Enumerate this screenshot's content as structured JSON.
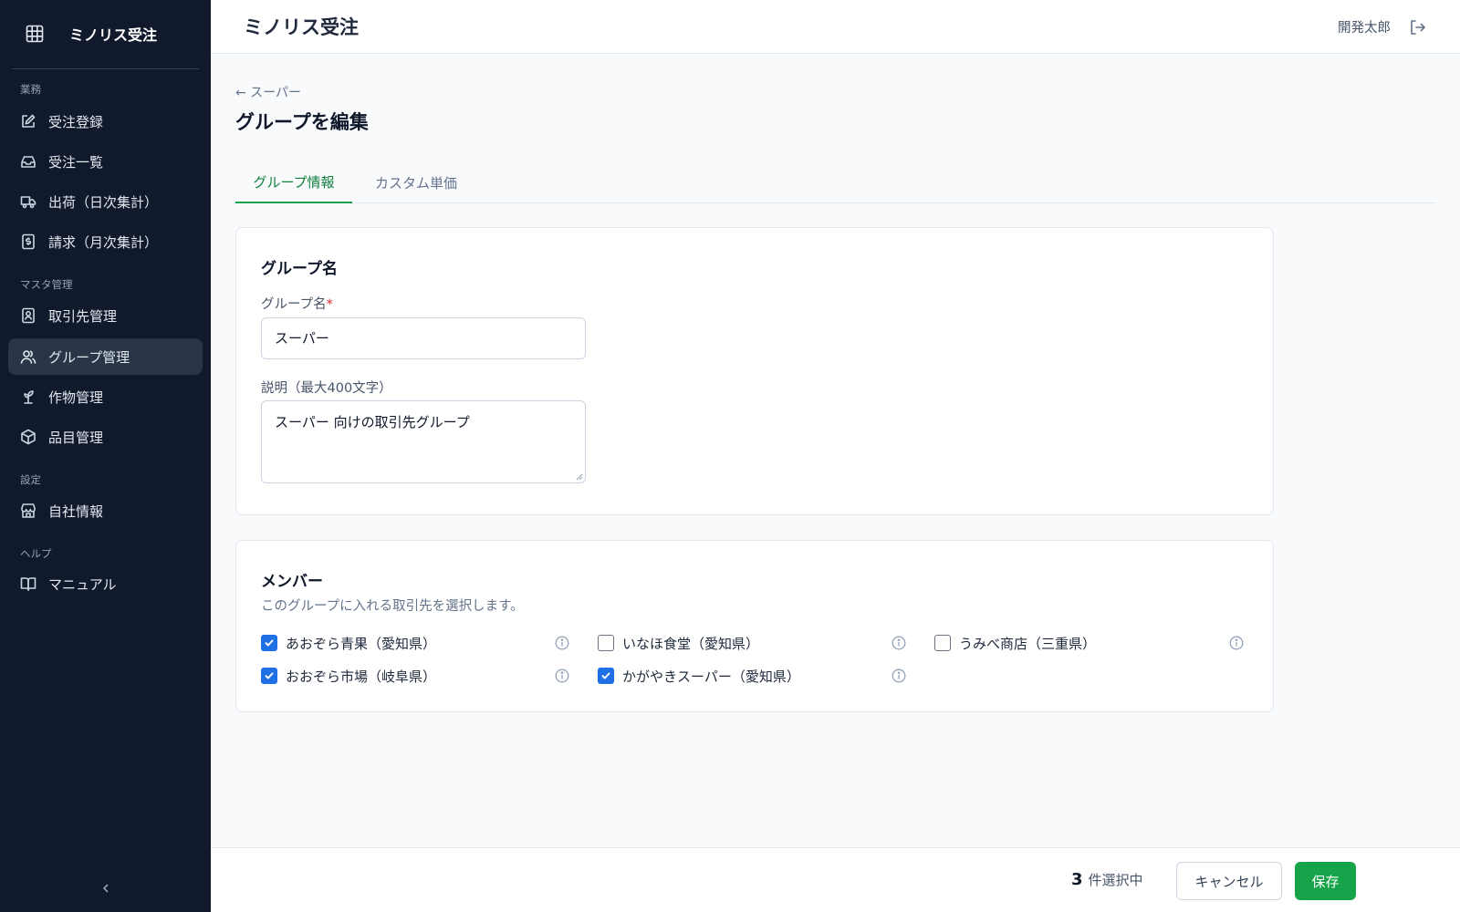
{
  "app": {
    "name": "ミノリス受注"
  },
  "header": {
    "title": "ミノリス受注",
    "user_name": "開発太郎"
  },
  "sidebar": {
    "sections": [
      {
        "label": "業務"
      },
      {
        "label": "マスタ管理"
      },
      {
        "label": "設定"
      },
      {
        "label": "ヘルプ"
      }
    ],
    "items": [
      {
        "label": "受注登録",
        "icon": "edit-icon"
      },
      {
        "label": "受注一覧",
        "icon": "inbox-icon"
      },
      {
        "label": "出荷（日次集計）",
        "icon": "truck-icon"
      },
      {
        "label": "請求（月次集計）",
        "icon": "invoice-icon"
      },
      {
        "label": "取引先管理",
        "icon": "contact-icon"
      },
      {
        "label": "グループ管理",
        "icon": "users-icon",
        "active": true
      },
      {
        "label": "作物管理",
        "icon": "sprout-icon"
      },
      {
        "label": "品目管理",
        "icon": "box-icon"
      },
      {
        "label": "自社情報",
        "icon": "store-icon"
      },
      {
        "label": "マニュアル",
        "icon": "book-icon"
      }
    ]
  },
  "page": {
    "back_label": "← スーパー",
    "title": "グループを編集"
  },
  "tabs": [
    {
      "label": "グループ情報",
      "active": true
    },
    {
      "label": "カスタム単価",
      "active": false
    }
  ],
  "group_card": {
    "title": "グループ名",
    "name_label": "グループ名",
    "required_mark": "*",
    "name_value": "スーパー",
    "desc_label": "説明（最大400文字）",
    "desc_value": "スーパー 向けの取引先グループ"
  },
  "members_card": {
    "title": "メンバー",
    "description": "このグループに入れる取引先を選択します。",
    "members": [
      {
        "label": "あおぞら青果（愛知県）",
        "checked": true
      },
      {
        "label": "いなほ食堂（愛知県）",
        "checked": false
      },
      {
        "label": "うみべ商店（三重県）",
        "checked": false
      },
      {
        "label": "おおぞら市場（岐阜県）",
        "checked": true
      },
      {
        "label": "かがやきスーパー（愛知県）",
        "checked": true
      }
    ]
  },
  "footer": {
    "selected_count": "3",
    "selected_suffix": "件選択中",
    "cancel_label": "キャンセル",
    "save_label": "保存"
  },
  "colors": {
    "sidebar_bg": "#111a2c",
    "accent_green": "#16a34a",
    "checkbox_blue": "#1f6fe5",
    "required_red": "#dc2626"
  }
}
